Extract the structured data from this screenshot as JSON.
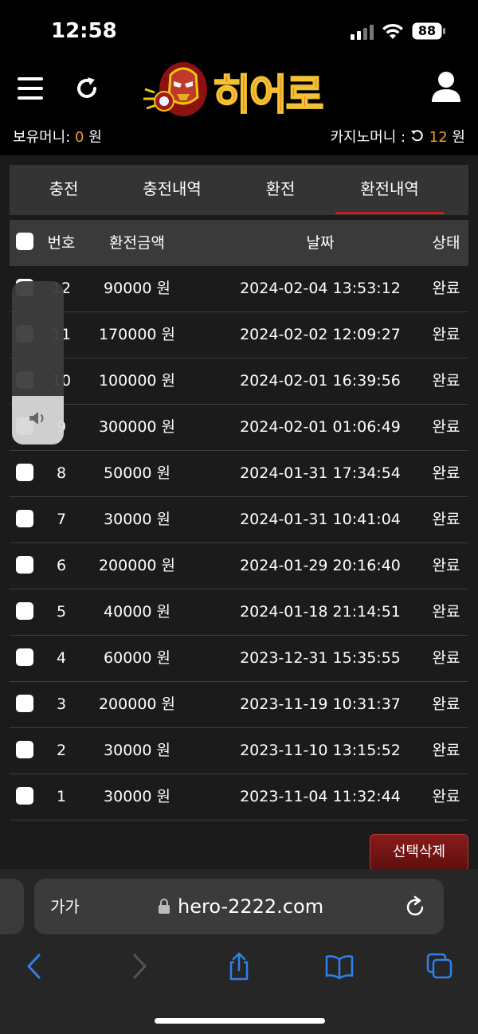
{
  "status_bar": {
    "time": "12:58",
    "battery": "88"
  },
  "header": {
    "logo_text": "히어로",
    "hold_money_label": "보유머니: ",
    "hold_money_value": "0",
    "hold_money_unit": " 원",
    "casino_money_label": "카지노머니 : ",
    "casino_money_value": "12",
    "casino_money_unit": " 원"
  },
  "tabs": [
    {
      "label": "충전"
    },
    {
      "label": "충전내역"
    },
    {
      "label": "환전"
    },
    {
      "label": "환전내역",
      "active": true
    }
  ],
  "table": {
    "columns": {
      "no": "번호",
      "amount": "환전금액",
      "date": "날짜",
      "status": "상태"
    },
    "rows": [
      {
        "no": "12",
        "amount": "90000 원",
        "date": "2024-02-04 13:53:12",
        "status": "완료"
      },
      {
        "no": "11",
        "amount": "170000 원",
        "date": "2024-02-02 12:09:27",
        "status": "완료"
      },
      {
        "no": "10",
        "amount": "100000 원",
        "date": "2024-02-01 16:39:56",
        "status": "완료"
      },
      {
        "no": "9",
        "amount": "300000 원",
        "date": "2024-02-01 01:06:49",
        "status": "완료"
      },
      {
        "no": "8",
        "amount": "50000 원",
        "date": "2024-01-31 17:34:54",
        "status": "완료"
      },
      {
        "no": "7",
        "amount": "30000 원",
        "date": "2024-01-31 10:41:04",
        "status": "완료"
      },
      {
        "no": "6",
        "amount": "200000 원",
        "date": "2024-01-29 20:16:40",
        "status": "완료"
      },
      {
        "no": "5",
        "amount": "40000 원",
        "date": "2024-01-18 21:14:51",
        "status": "완료"
      },
      {
        "no": "4",
        "amount": "60000 원",
        "date": "2023-12-31 15:35:55",
        "status": "완료"
      },
      {
        "no": "3",
        "amount": "200000 원",
        "date": "2023-11-19 10:31:37",
        "status": "완료"
      },
      {
        "no": "2",
        "amount": "30000 원",
        "date": "2023-11-10 13:15:52",
        "status": "완료"
      },
      {
        "no": "1",
        "amount": "30000 원",
        "date": "2023-11-04 11:32:44",
        "status": "완료"
      }
    ]
  },
  "delete_button_label": "선택삭제",
  "volume_level": 0.3,
  "browser": {
    "text_size_label": "가가",
    "url": "hero-2222.com"
  },
  "colors": {
    "accent_orange": "#f39c2b",
    "active_tab_underline": "#c22222",
    "delete_button": "#7a1515"
  }
}
